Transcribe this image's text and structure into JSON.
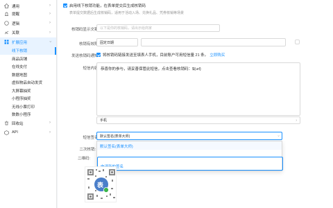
{
  "sidebar": {
    "items": [
      {
        "label": "通用",
        "icon": "home-icon"
      },
      {
        "label": "提醒",
        "icon": "bell-icon"
      },
      {
        "label": "逻辑",
        "icon": "logic-icon"
      },
      {
        "label": "关联",
        "icon": "link-icon"
      },
      {
        "label": "扩展应用",
        "icon": "apps-icon"
      }
    ],
    "subitems": [
      "线下核销",
      "商品店铺",
      "在线支付",
      "数据地图",
      "虚拟物品自动发货",
      "大屏幕抽奖",
      "小程序抽奖",
      "无线小票打印",
      "数数小程序"
    ],
    "bottom": [
      {
        "label": "回收站",
        "icon": "trash-icon"
      },
      {
        "label": "API",
        "icon": "api-icon"
      }
    ]
  },
  "main": {
    "enable_label": "启用线下核销功能，在表单提交后生成核销码",
    "enable_hint": "表单提交数据后生成核销码，适用于活动入场、兑换礼品、凭券核销等场景",
    "code_label": "核销码显示文案:",
    "code_placeholder": "以下是你的核销码，请出示给商家",
    "expire_label": "核销有效期:",
    "expire_value": "固定日期",
    "notify_label": "发送核销码通知:",
    "notify_text": "将核销码链接发送至填表人手机，目前账户可用短信量 21 条。",
    "notify_link": "立即购买",
    "sms_label": "短信内容:",
    "sms_text": "恭喜你的参与，请妥善保管此短信，点击查看核销码：${url}",
    "phone_label": "手机",
    "sign_label": "短信签名:",
    "sign_value": "默认签名(表单大师)",
    "dropdown_option": "默认签名(表单大师)",
    "dropdown_link": "申请新的签名",
    "second_label": "二次核销:",
    "qr_label": "二维码:",
    "qr_char": "表"
  }
}
